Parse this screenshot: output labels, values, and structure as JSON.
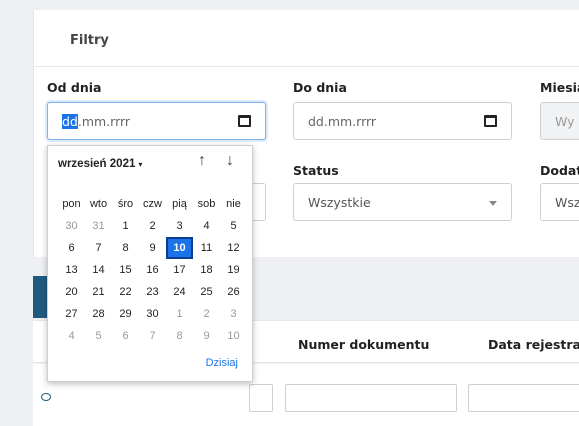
{
  "filters": {
    "title": "Filtry",
    "from_label": "Od dnia",
    "from_value_hl": "dd",
    "from_value_rest": ".mm.rrrr",
    "to_label": "Do dnia",
    "to_value": "dd.mm.rrrr",
    "month_label": "Miesią",
    "month_value": "Wy",
    "status_label": "Status",
    "status_value": "Wszystkie",
    "extra_label": "Dodat",
    "extra_value": "Wsz"
  },
  "table": {
    "col_doc_number": "Numer dokumentu",
    "col_reg_date": "Data rejestracj"
  },
  "calendar": {
    "month_year": "wrzesień 2021",
    "dropdown_glyph": "▾",
    "prev_glyph": "↑",
    "next_glyph": "↓",
    "today_label": "Dzisiaj",
    "weekdays": [
      "pon",
      "wto",
      "śro",
      "czw",
      "pią",
      "sob",
      "nie"
    ],
    "weeks": [
      [
        {
          "d": "30",
          "o": true
        },
        {
          "d": "31",
          "o": true
        },
        {
          "d": "1"
        },
        {
          "d": "2"
        },
        {
          "d": "3"
        },
        {
          "d": "4"
        },
        {
          "d": "5"
        }
      ],
      [
        {
          "d": "6"
        },
        {
          "d": "7"
        },
        {
          "d": "8"
        },
        {
          "d": "9"
        },
        {
          "d": "10",
          "s": true
        },
        {
          "d": "11"
        },
        {
          "d": "12"
        }
      ],
      [
        {
          "d": "13"
        },
        {
          "d": "14"
        },
        {
          "d": "15"
        },
        {
          "d": "16"
        },
        {
          "d": "17"
        },
        {
          "d": "18"
        },
        {
          "d": "19"
        }
      ],
      [
        {
          "d": "20"
        },
        {
          "d": "21"
        },
        {
          "d": "22"
        },
        {
          "d": "23"
        },
        {
          "d": "24"
        },
        {
          "d": "25"
        },
        {
          "d": "26"
        }
      ],
      [
        {
          "d": "27"
        },
        {
          "d": "28"
        },
        {
          "d": "29"
        },
        {
          "d": "30"
        },
        {
          "d": "1",
          "o": true
        },
        {
          "d": "2",
          "o": true
        },
        {
          "d": "3",
          "o": true
        }
      ],
      [
        {
          "d": "4",
          "o": true
        },
        {
          "d": "5",
          "o": true
        },
        {
          "d": "6",
          "o": true
        },
        {
          "d": "7",
          "o": true
        },
        {
          "d": "8",
          "o": true
        },
        {
          "d": "9",
          "o": true
        },
        {
          "d": "10",
          "o": true
        }
      ]
    ]
  },
  "colors": {
    "accent": "#1a73e8",
    "tab_button": "#1f5b80"
  }
}
